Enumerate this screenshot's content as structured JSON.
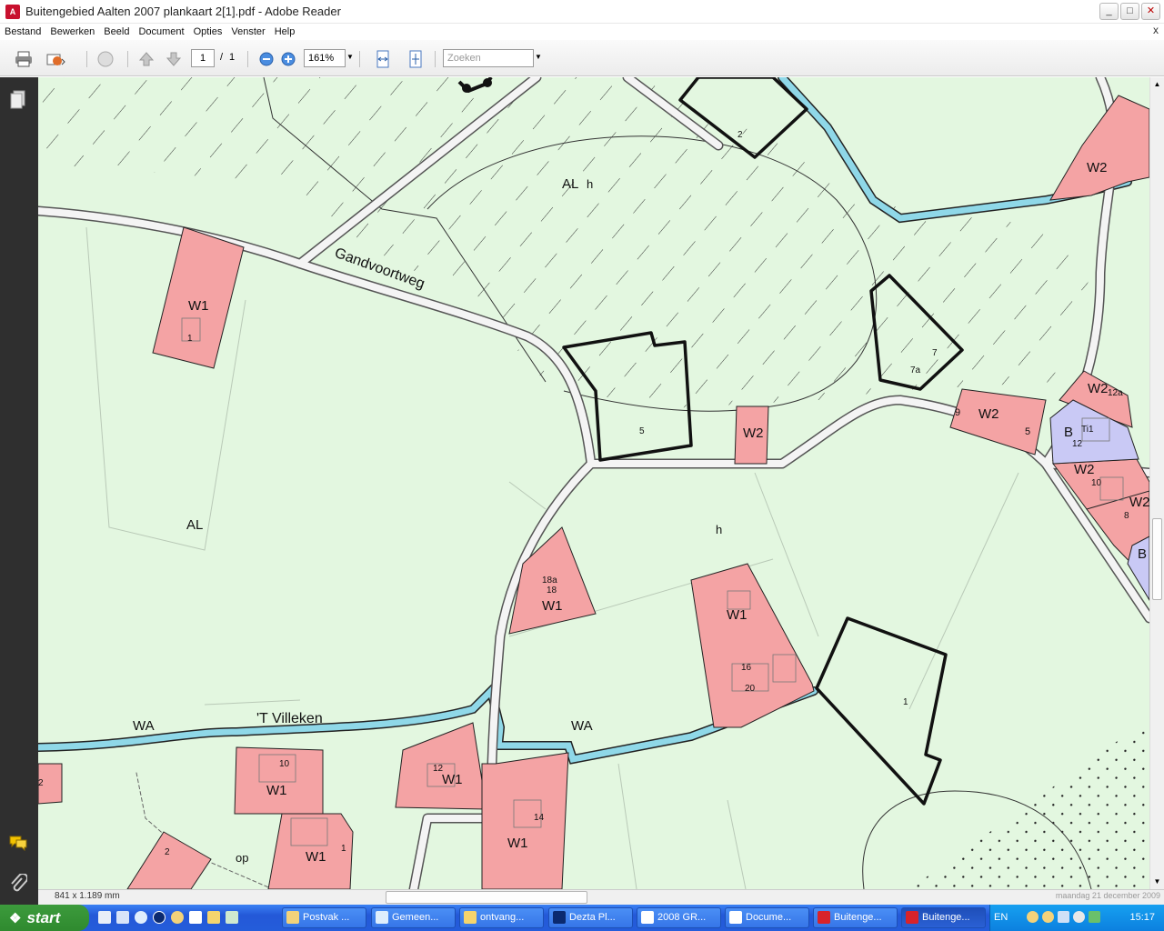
{
  "window": {
    "title": "Buitengebied Aalten 2007 plankaart 2[1].pdf - Adobe Reader",
    "app_icon": "pdf-icon",
    "buttons": [
      "_",
      "□",
      "✕"
    ]
  },
  "menu": {
    "items": [
      "Bestand",
      "Bewerken",
      "Beeld",
      "Document",
      "Opties",
      "Venster",
      "Help"
    ],
    "close_glyph": "x"
  },
  "toolbar": {
    "page_current": "1",
    "page_sep": "/",
    "page_total": "1",
    "zoom": "161%",
    "search_placeholder": "Zoeken"
  },
  "status": {
    "page_size": "841 x 1.189 mm"
  },
  "map": {
    "road_names": [
      "Gandvoortweg",
      "'T Villeken"
    ],
    "zones": [
      "AL",
      "AL",
      "h",
      "h",
      "WA",
      "WA",
      "op"
    ],
    "zone_labels": {
      "al_top": "AL",
      "al_left": "AL",
      "h_top": "h",
      "h_mid": "h",
      "wa_left": "WA",
      "wa_right": "WA",
      "op": "op"
    },
    "parcels": {
      "p1": {
        "code": "W1",
        "num": "1"
      },
      "p2": {
        "code": "W2",
        "num": ""
      },
      "p3": {
        "code": "W2",
        "num": ""
      },
      "p4": {
        "code": "W2",
        "num1": "9",
        "num2": "5"
      },
      "p5": {
        "code": "W2",
        "num": "12a"
      },
      "p6": {
        "code": "B",
        "sub": "Ti1",
        "num": "12"
      },
      "p7": {
        "code": "W2",
        "num": "10"
      },
      "p8": {
        "code": "W2",
        "num": "8"
      },
      "p9": {
        "code": "B"
      },
      "p10": {
        "code": "W1",
        "num1": "18a",
        "num2": "18"
      },
      "p11": {
        "code": "W1",
        "num1": "16",
        "num2": "20"
      },
      "p12": {
        "code": "W1",
        "num": "10"
      },
      "p13": {
        "code": "W1",
        "num": "12"
      },
      "p14": {
        "code": "W1",
        "num": "14"
      },
      "p15": {
        "code": "W1",
        "num": "1"
      },
      "p16": {
        "code": "",
        "num": "2"
      },
      "p17": {
        "code": "",
        "num": "2"
      }
    },
    "outlined": {
      "o1": "2",
      "o2": "5",
      "o3a": "7",
      "o3b": "7a",
      "o4": "1"
    }
  },
  "taskbar": {
    "start": "start",
    "items": [
      "Postvak ...",
      "Gemeen...",
      "ontvang...",
      "Dezta Pl...",
      "2008 GR...",
      "Docume...",
      "Buitenge...",
      "Buitenge..."
    ],
    "lang": "EN",
    "clock": "15:17",
    "tooltip": "maandag 21 december 2009"
  },
  "colors": {
    "map_bg": "#e3f7e0",
    "parcel_red": "#f4a3a4",
    "parcel_blue": "#c9c9f5",
    "water": "#8fd8e8"
  }
}
